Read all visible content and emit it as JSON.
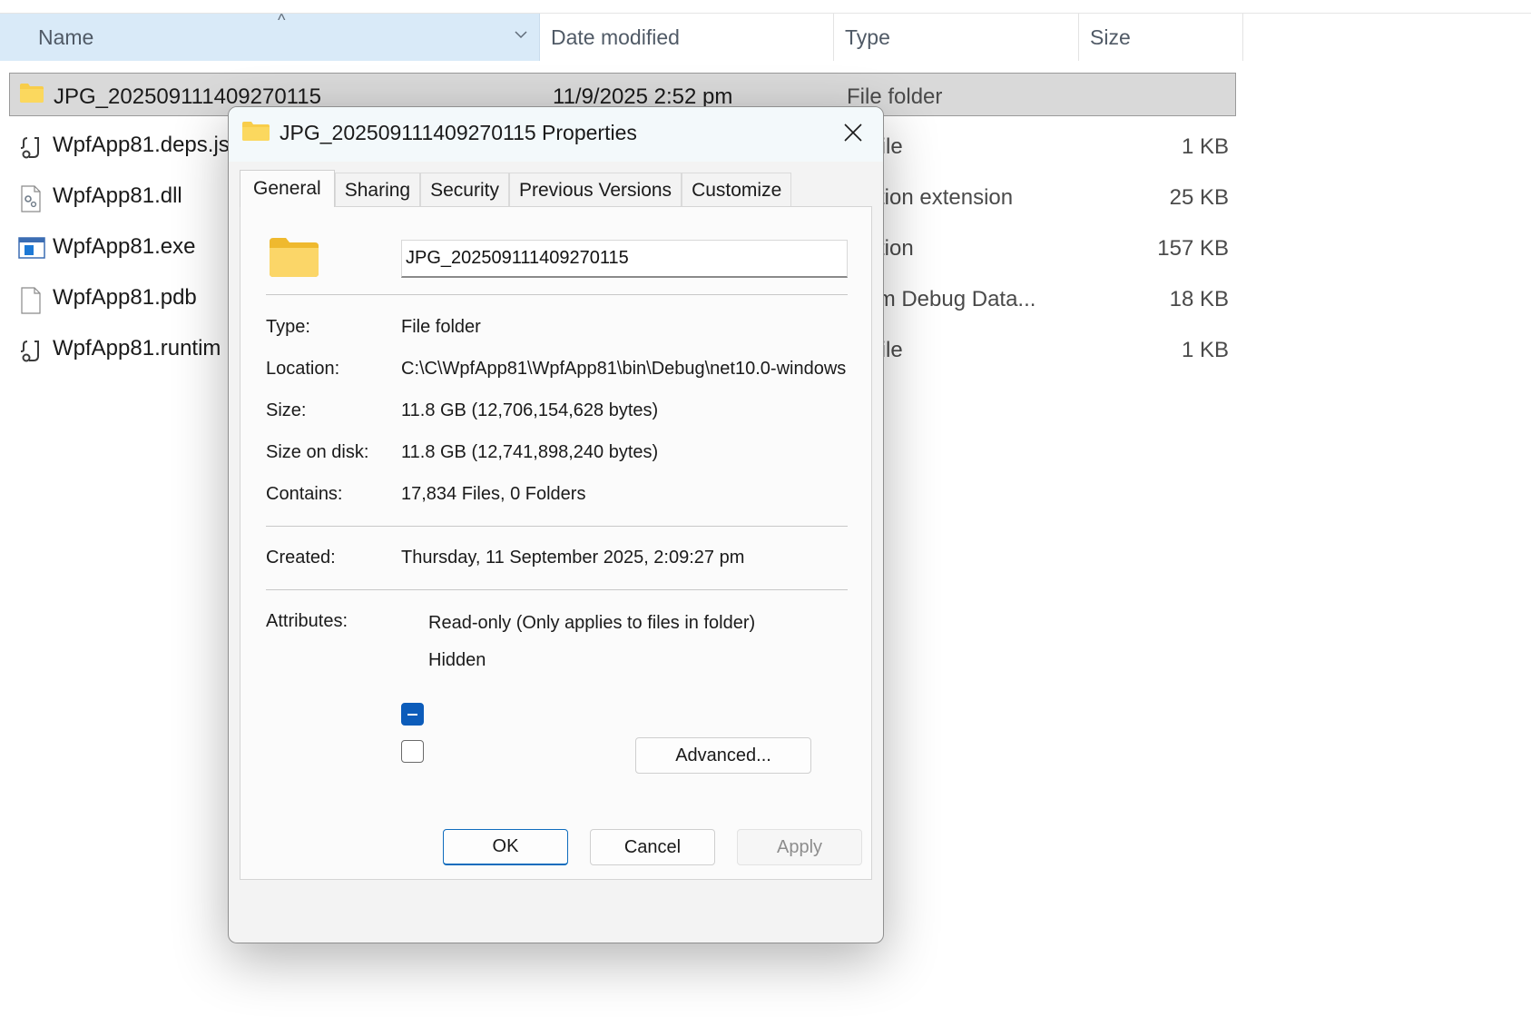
{
  "explorer": {
    "columns": {
      "name": "Name",
      "date": "Date modified",
      "type": "Type",
      "size": "Size"
    },
    "files": [
      {
        "name": "JPG_20250911140927011​5",
        "date": "11/9/2025 2:52 pm",
        "type": "File folder",
        "size": "",
        "icon": "folder-icon",
        "selected": true
      },
      {
        "name": "WpfApp81.deps.js",
        "date": "",
        "type": "N File",
        "size": "1 KB",
        "icon": "json-file-icon"
      },
      {
        "name": "WpfApp81.dll",
        "date": "",
        "type": "lication extension",
        "size": "25 KB",
        "icon": "dll-file-icon"
      },
      {
        "name": "WpfApp81.exe",
        "date": "",
        "type": "lication",
        "size": "157 KB",
        "icon": "exe-file-icon"
      },
      {
        "name": "WpfApp81.pdb",
        "date": "",
        "type": "gram Debug Data...",
        "size": "18 KB",
        "icon": "blank-file-icon"
      },
      {
        "name": "WpfApp81.runtim",
        "date": "",
        "type": "N File",
        "size": "1 KB",
        "icon": "json-file-icon"
      }
    ]
  },
  "dialog": {
    "title": "JPG_20250911140927011​5 Properties",
    "tabs": [
      "General",
      "Sharing",
      "Security",
      "Previous Versions",
      "Customize"
    ],
    "active_tab": "General",
    "folder_name": "JPG_20250911140927011​5",
    "fields": {
      "type_label": "Type:",
      "type_value": "File folder",
      "location_label": "Location:",
      "location_value": "C:\\C\\WpfApp81\\WpfApp81\\bin\\Debug\\net10.0-windows",
      "size_label": "Size:",
      "size_value": "11.8 GB (12,706,154,628 bytes)",
      "size_on_disk_label": "Size on disk:",
      "size_on_disk_value": "11.8 GB (12,741,898,240 bytes)",
      "contains_label": "Contains:",
      "contains_value": "17,834 Files, 0 Folders",
      "created_label": "Created:",
      "created_value": "Thursday, 11 September 2025, 2:09:27 pm",
      "attributes_label": "Attributes:"
    },
    "attributes": {
      "readonly_label": "Read-only (Only applies to files in folder)",
      "readonly_state": "indeterminate",
      "hidden_label": "Hidden",
      "hidden_state": "unchecked",
      "advanced_label": "Advanced..."
    },
    "buttons": {
      "ok": "OK",
      "cancel": "Cancel",
      "apply": "Apply"
    }
  },
  "colors": {
    "header_selected": "#d9eaf8",
    "row_selected": "#d9d9d9",
    "accent": "#0c5cba",
    "folder_yellow": "#f8cd4a"
  }
}
